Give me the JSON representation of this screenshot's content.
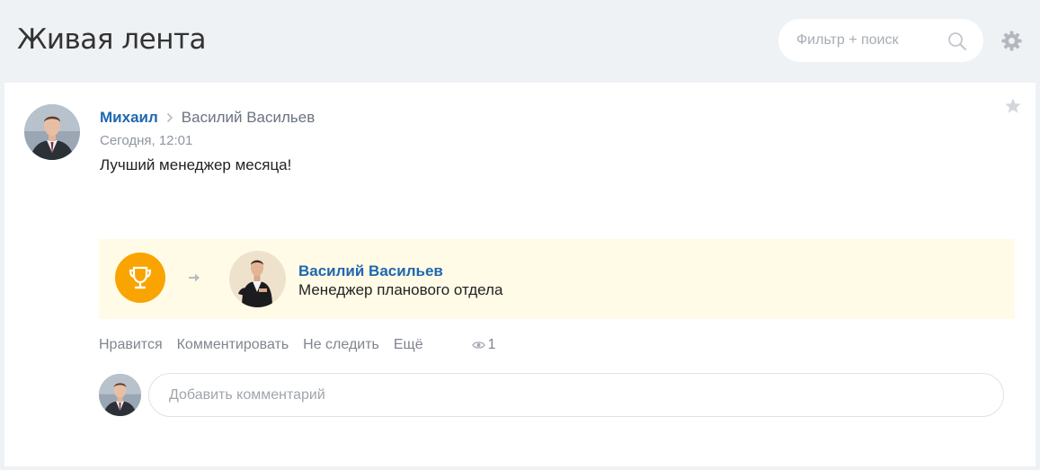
{
  "header": {
    "title": "Живая лента",
    "search_placeholder": "Фильтр + поиск"
  },
  "post": {
    "author": "Михаил",
    "recipient": "Василий Васильев",
    "date": "Сегодня, 12:01",
    "text": "Лучший менеджер месяца!",
    "award": {
      "name": "Василий Васильев",
      "position": "Менеджер планового отдела"
    },
    "actions": {
      "like": "Нравится",
      "comment": "Комментировать",
      "unfollow": "Не следить",
      "more": "Ещё"
    },
    "views": "1",
    "comment_placeholder": "Добавить комментарий"
  },
  "colors": {
    "accent_link": "#2067b0",
    "trophy": "#f9a400",
    "award_bg": "#fffbe7",
    "page_bg": "#eef2f5"
  },
  "icons": [
    "search-icon",
    "gear-icon",
    "star-icon",
    "chevron-right-icon",
    "trophy-icon",
    "arrow-right-icon",
    "eye-icon"
  ]
}
